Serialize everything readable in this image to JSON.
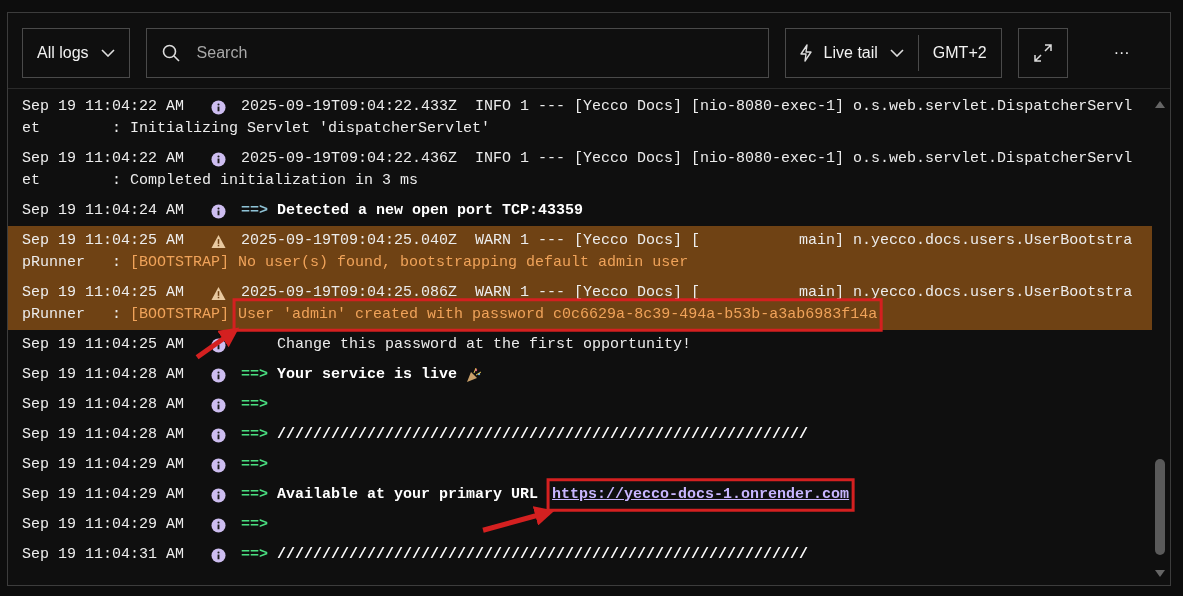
{
  "toolbar": {
    "log_filter": "All logs",
    "search": {
      "placeholder": "Search"
    },
    "live_tail": "Live tail",
    "timezone": "GMT+2",
    "more": "···"
  },
  "entries": [
    {
      "time": "Sep 19 11:04:22 AM",
      "kind": "info",
      "lines": [
        [
          {
            "kind": "plain",
            "text": "2025-09-19T09:04:22.433Z  INFO 1 --- [Yecco Docs] [nio-8080-exec-1] o.s.web.servlet.DispatcherServl"
          }
        ],
        [
          {
            "kind": "plain",
            "text": "et        : Initializing Servlet 'dispatcherServlet'"
          }
        ]
      ]
    },
    {
      "time": "Sep 19 11:04:22 AM",
      "kind": "info",
      "lines": [
        [
          {
            "kind": "plain",
            "text": "2025-09-19T09:04:22.436Z  INFO 1 --- [Yecco Docs] [nio-8080-exec-1] o.s.web.servlet.DispatcherServl"
          }
        ],
        [
          {
            "kind": "plain",
            "text": "et        : Completed initialization in 3 ms"
          }
        ]
      ]
    },
    {
      "time": "Sep 19 11:04:24 AM",
      "kind": "info",
      "lines": [
        [
          {
            "kind": "arrow-muted",
            "text": "==>"
          },
          {
            "kind": "bold",
            "text": "Detected a new open port TCP:43359"
          }
        ]
      ]
    },
    {
      "time": "Sep 19 11:04:25 AM",
      "kind": "warn",
      "lines": [
        [
          {
            "kind": "plain",
            "text": "2025-09-19T09:04:25.040Z  WARN 1 --- [Yecco Docs] [           main] n.yecco.docs.users.UserBootstra"
          }
        ],
        [
          {
            "kind": "plain",
            "text": "pRunner   :"
          },
          {
            "kind": "orange",
            "text": "[BOOTSTRAP]"
          },
          {
            "kind": "orange",
            "text": "No user(s) found, bootstrapping default admin user"
          }
        ]
      ]
    },
    {
      "time": "Sep 19 11:04:25 AM",
      "kind": "warn",
      "lines": [
        [
          {
            "kind": "plain",
            "text": "2025-09-19T09:04:25.086Z  WARN 1 --- [Yecco Docs] [           main] n.yecco.docs.users.UserBootstra"
          }
        ],
        [
          {
            "kind": "plain",
            "text": "pRunner   :"
          },
          {
            "kind": "orange",
            "text": "[BOOTSTRAP]"
          },
          {
            "kind": "orange",
            "text": "User 'admin' created with password c0c6629a-8c39-494a-b53b-a3ab6983f14a",
            "highlighted": true
          }
        ]
      ]
    },
    {
      "time": "Sep 19 11:04:25 AM",
      "kind": "info",
      "lines": [
        [
          {
            "kind": "plain",
            "text": "    Change this password at the first opportunity!"
          }
        ]
      ]
    },
    {
      "time": "Sep 19 11:04:28 AM",
      "kind": "info",
      "celebration": true,
      "lines": [
        [
          {
            "kind": "arrow",
            "text": "==>"
          },
          {
            "kind": "bold",
            "text": "Your service is live"
          }
        ]
      ]
    },
    {
      "time": "Sep 19 11:04:28 AM",
      "kind": "info",
      "lines": [
        [
          {
            "kind": "arrow",
            "text": "==>"
          }
        ]
      ]
    },
    {
      "time": "Sep 19 11:04:28 AM",
      "kind": "info",
      "lines": [
        [
          {
            "kind": "arrow",
            "text": "==>"
          },
          {
            "kind": "bold",
            "text": "///////////////////////////////////////////////////////////"
          }
        ]
      ]
    },
    {
      "time": "Sep 19 11:04:29 AM",
      "kind": "info",
      "lines": [
        [
          {
            "kind": "arrow",
            "text": "==>"
          }
        ]
      ]
    },
    {
      "time": "Sep 19 11:04:29 AM",
      "kind": "info",
      "lines": [
        [
          {
            "kind": "arrow",
            "text": "==>"
          },
          {
            "kind": "bold",
            "text": "Available at your primary URL"
          },
          {
            "kind": "link",
            "text": "https://yecco-docs-1.onrender.com",
            "highlighted": true
          }
        ]
      ]
    },
    {
      "time": "Sep 19 11:04:29 AM",
      "kind": "info",
      "lines": [
        [
          {
            "kind": "arrow",
            "text": "==>"
          }
        ]
      ]
    },
    {
      "time": "Sep 19 11:04:31 AM",
      "kind": "info",
      "lines": [
        [
          {
            "kind": "arrow",
            "text": "==>"
          },
          {
            "kind": "bold",
            "text": "///////////////////////////////////////////////////////////"
          }
        ]
      ]
    }
  ]
}
